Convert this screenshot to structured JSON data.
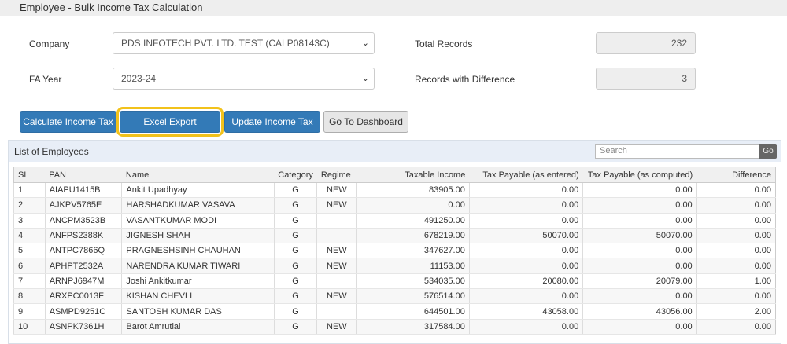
{
  "title": "Employee - Bulk Income Tax Calculation",
  "form": {
    "company_label": "Company",
    "company_value": "PDS INFOTECH PVT. LTD. TEST (CALP08143C)",
    "fa_year_label": "FA Year",
    "fa_year_value": "2023-24",
    "total_records_label": "Total Records",
    "total_records_value": "232",
    "records_diff_label": "Records with Difference",
    "records_diff_value": "3"
  },
  "buttons": {
    "calculate": "Calculate Income Tax",
    "excel": "Excel Export",
    "update": "Update Income Tax",
    "dashboard": "Go To Dashboard"
  },
  "list": {
    "title": "List of Employees",
    "search_placeholder": "Search",
    "go": "Go",
    "columns": [
      "SL",
      "PAN",
      "Name",
      "Category",
      "Regime",
      "Taxable Income",
      "Tax Payable (as entered)",
      "Tax Payable (as computed)",
      "Difference"
    ],
    "rows": [
      [
        "1",
        "AIAPU1415B",
        "Ankit Upadhyay",
        "G",
        "NEW",
        "83905.00",
        "0.00",
        "0.00",
        "0.00"
      ],
      [
        "2",
        "AJKPV5765E",
        "HARSHADKUMAR VASAVA",
        "G",
        "NEW",
        "0.00",
        "0.00",
        "0.00",
        "0.00"
      ],
      [
        "3",
        "ANCPM3523B",
        "VASANTKUMAR MODI",
        "G",
        "",
        "491250.00",
        "0.00",
        "0.00",
        "0.00"
      ],
      [
        "4",
        "ANFPS2388K",
        "JIGNESH SHAH",
        "G",
        "",
        "678219.00",
        "50070.00",
        "50070.00",
        "0.00"
      ],
      [
        "5",
        "ANTPC7866Q",
        "PRAGNESHSINH CHAUHAN",
        "G",
        "NEW",
        "347627.00",
        "0.00",
        "0.00",
        "0.00"
      ],
      [
        "6",
        "APHPT2532A",
        "NARENDRA KUMAR TIWARI",
        "G",
        "NEW",
        "11153.00",
        "0.00",
        "0.00",
        "0.00"
      ],
      [
        "7",
        "ARNPJ6947M",
        "Joshi Ankitkumar",
        "G",
        "",
        "534035.00",
        "20080.00",
        "20079.00",
        "1.00"
      ],
      [
        "8",
        "ARXPC0013F",
        "KISHAN CHEVLI",
        "G",
        "NEW",
        "576514.00",
        "0.00",
        "0.00",
        "0.00"
      ],
      [
        "9",
        "ASMPD9251C",
        "SANTOSH KUMAR DAS",
        "G",
        "",
        "644501.00",
        "43058.00",
        "43056.00",
        "2.00"
      ],
      [
        "10",
        "ASNPK7361H",
        "Barot Amrutlal",
        "G",
        "NEW",
        "317584.00",
        "0.00",
        "0.00",
        "0.00"
      ]
    ]
  }
}
